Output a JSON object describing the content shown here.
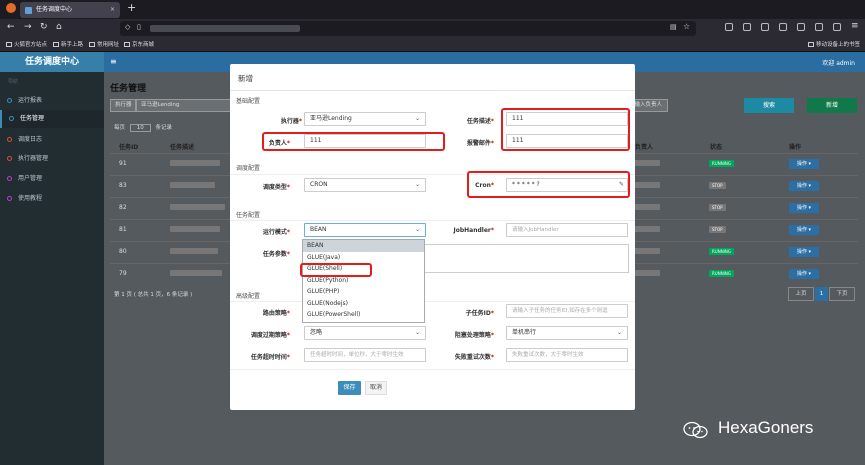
{
  "browser": {
    "tab_title": "任务调度中心",
    "close_symbol": "×",
    "new_tab_symbol": "+",
    "bookmarks": [
      "火狐官方站点",
      "新手上路",
      "常用网址",
      "京东商城"
    ],
    "bookmark_right": "移动设备上的书签"
  },
  "app": {
    "brand": "任务调度中心",
    "sidebar_header": "导航",
    "user": "欢迎 admin",
    "sidebar": [
      "运行报表",
      "任务管理",
      "调度日志",
      "执行器管理",
      "用户管理",
      "使用教程"
    ],
    "active_item": 1,
    "page_title": "任务管理",
    "filter": {
      "executor_label": "执行器",
      "executor_value": "亚马逊Lending",
      "owner_placeholder": "请输入负责人",
      "search_btn": "搜索",
      "add_btn": "新增"
    },
    "page_size": {
      "prefix": "每页",
      "value": "10",
      "suffix": "条记录"
    },
    "table": {
      "headers": [
        "任务ID",
        "任务描述",
        "负责人",
        "状态",
        "操作"
      ],
      "rows": [
        {
          "id": "91",
          "status": "RUNNING"
        },
        {
          "id": "83",
          "status": "STOP"
        },
        {
          "id": "82",
          "status": "STOP"
        },
        {
          "id": "81",
          "status": "STOP"
        },
        {
          "id": "80",
          "status": "RUNNING"
        },
        {
          "id": "79",
          "status": "RUNNING"
        }
      ],
      "op_label": "操作 ▾"
    },
    "footer_info": "第 1 页 ( 总共 1 页，6 条记录 )",
    "pager": {
      "prev": "上页",
      "current": "1",
      "next": "下页"
    }
  },
  "modal": {
    "title": "新增",
    "sections": {
      "basic": "基础配置",
      "schedule": "调度配置",
      "task": "任务配置",
      "advanced": "高级配置"
    },
    "fields": {
      "executor": {
        "label": "执行器",
        "value": "亚马逊Lending"
      },
      "desc": {
        "label": "任务描述",
        "value": "111"
      },
      "owner": {
        "label": "负责人",
        "value": "111"
      },
      "email": {
        "label": "报警邮件",
        "value": "111"
      },
      "schedule_type": {
        "label": "调度类型",
        "value": "CRON"
      },
      "cron": {
        "label": "Cron",
        "value": "* * * * * ?"
      },
      "run_mode": {
        "label": "运行模式",
        "value": "BEAN"
      },
      "job_handler": {
        "label": "JobHandler",
        "placeholder": "请输入JobHandler"
      },
      "params": {
        "label": "任务参数"
      },
      "route": {
        "label": "路由策略"
      },
      "child": {
        "label": "子任务ID",
        "placeholder": "请输入子任务的任务ID,如存在多个则逗"
      },
      "misfire": {
        "label": "调度过期策略",
        "value": "忽略"
      },
      "block": {
        "label": "阻塞处理策略",
        "value": "单机串行"
      },
      "timeout": {
        "label": "任务超时时间",
        "placeholder": "任务超时时间，单位秒，大于零时生效"
      },
      "retry": {
        "label": "失败重试次数",
        "placeholder": "失败重试次数，大于零时生效"
      }
    },
    "run_mode_options": [
      "BEAN",
      "GLUE(Java)",
      "GLUE(Shell)",
      "GLUE(Python)",
      "GLUE(PHP)",
      "GLUE(Nodejs)",
      "GLUE(PowerShell)"
    ],
    "save": "保存",
    "cancel": "取消"
  },
  "watermark": "HexaGoners",
  "colors": {
    "running": "#00a65a",
    "stop": "#777777",
    "primary": "#3c8dbc",
    "highlight": "#e21d1d",
    "teal": "#00c0ef"
  }
}
